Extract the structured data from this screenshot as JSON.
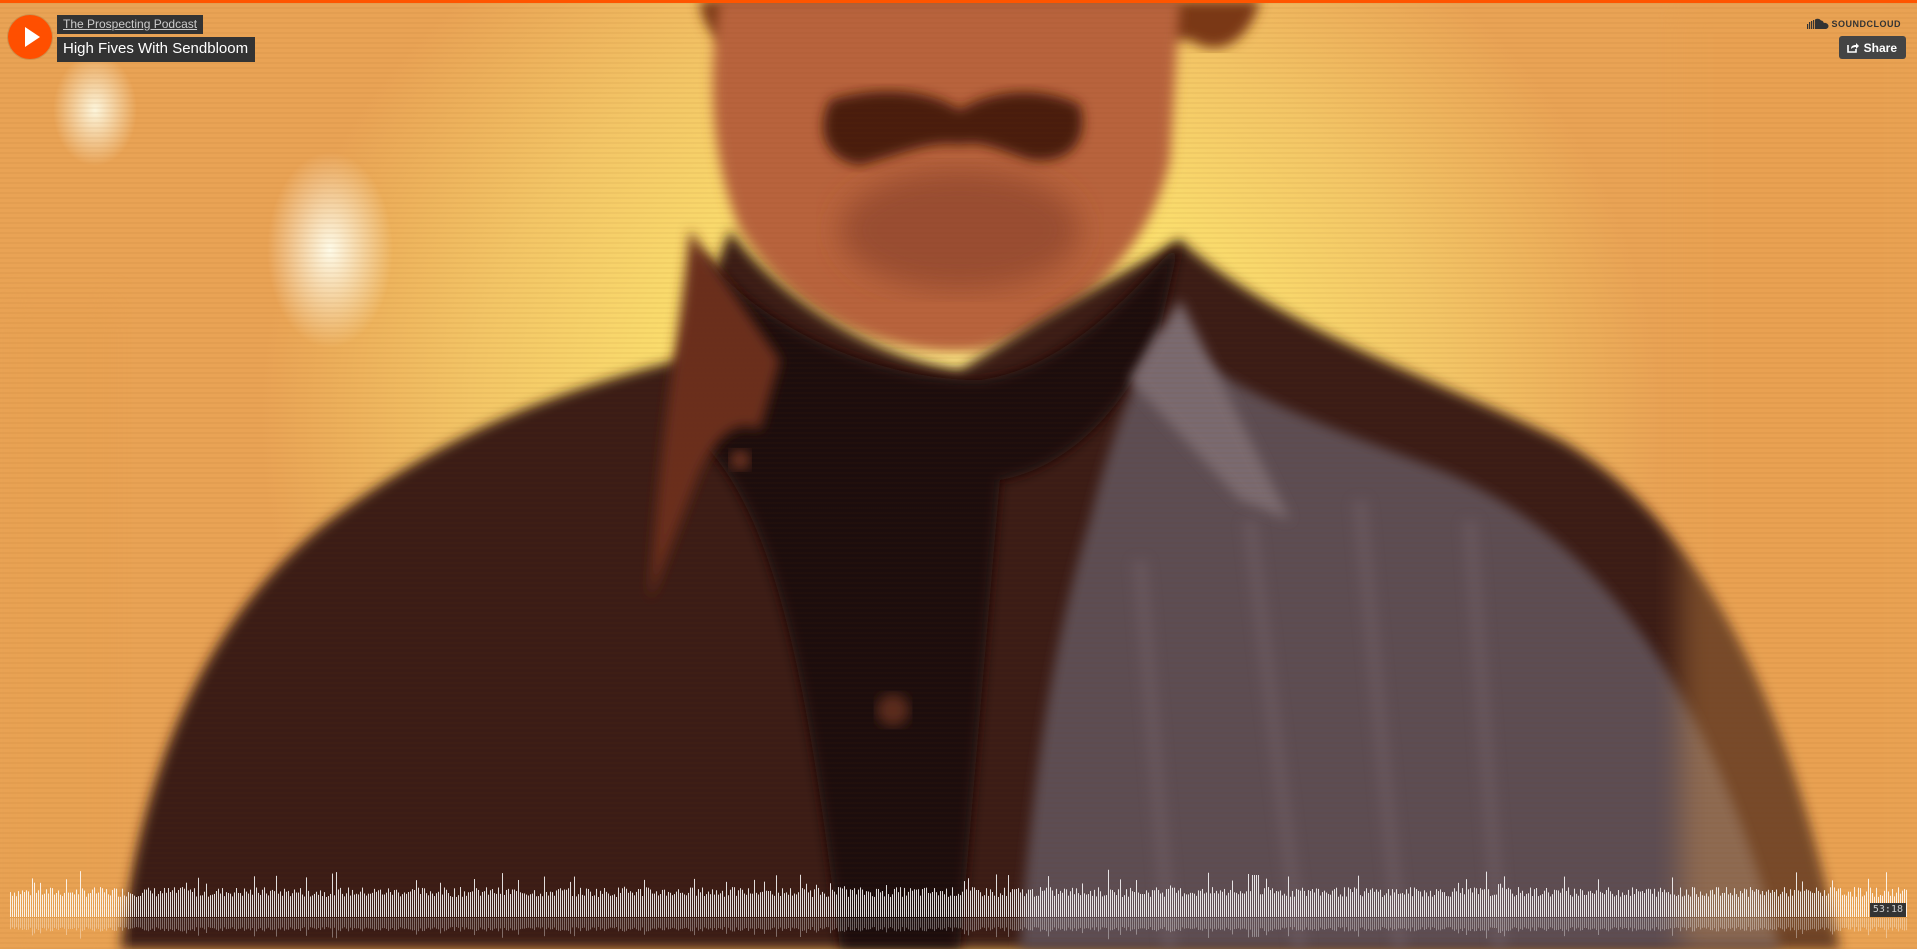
{
  "player": {
    "uploader": "The Prospecting Podcast",
    "title": "High Fives With Sendbloom",
    "duration": "53:18"
  },
  "branding": {
    "logo_text": "SOUNDCLOUD"
  },
  "actions": {
    "share_label": "Share"
  },
  "icons": {
    "play": "play-icon",
    "logo": "soundcloud-cloud-icon",
    "share": "share-icon"
  },
  "colors": {
    "accent": "#ff5500",
    "label_bg": "#333333",
    "waveform": "#ffffff"
  }
}
